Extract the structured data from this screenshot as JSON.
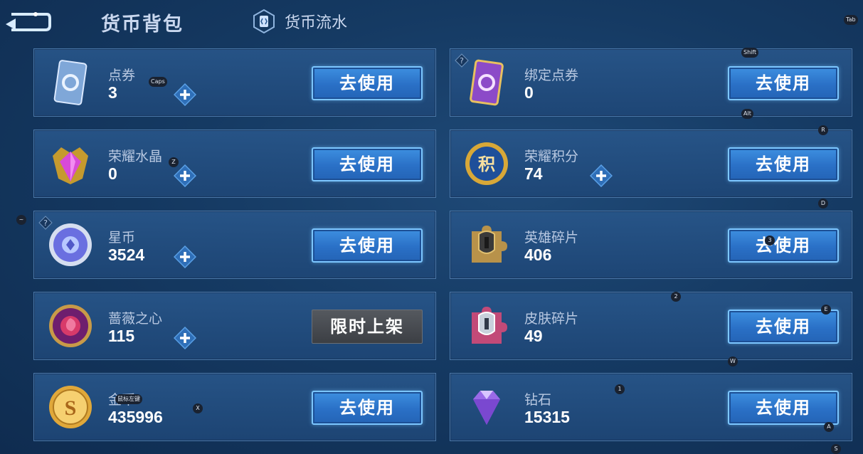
{
  "header": {
    "back_icon": "back-arrow-icon",
    "tab_backpack": "货币背包",
    "tab_flow": "货币流水",
    "flow_icon": "currency-flow-icon"
  },
  "use_label": "去使用",
  "left": [
    {
      "name": "点券",
      "amount": "3",
      "icon": "coupon-card-icon",
      "plus": true
    },
    {
      "name": "荣耀水晶",
      "amount": "0",
      "icon": "glory-crystal-icon",
      "plus": true
    },
    {
      "name": "星币",
      "amount": "3524",
      "icon": "star-coin-icon",
      "plus": true,
      "help": true
    },
    {
      "name": "蔷薇之心",
      "amount": "115",
      "icon": "rose-heart-icon",
      "plus": true,
      "button": "限时上架"
    },
    {
      "name": "金币",
      "amount": "435996",
      "icon": "gold-coin-icon",
      "plus": false
    }
  ],
  "right": [
    {
      "name": "绑定点券",
      "amount": "0",
      "icon": "bound-coupon-icon",
      "help": true
    },
    {
      "name": "荣耀积分",
      "amount": "74",
      "icon": "glory-points-icon",
      "plus": true
    },
    {
      "name": "英雄碎片",
      "amount": "406",
      "icon": "hero-fragment-icon"
    },
    {
      "name": "皮肤碎片",
      "amount": "49",
      "icon": "skin-fragment-icon"
    },
    {
      "name": "钻石",
      "amount": "15315",
      "icon": "diamond-icon"
    }
  ],
  "key_hints": {
    "tab": "Tab",
    "shift": "Shift",
    "caps": "Caps",
    "alt": "Alt",
    "r": "R",
    "z": "Z",
    "d": "D",
    "tilde": "~",
    "three": "3",
    "two": "2",
    "e": "E",
    "w": "W",
    "one": "1",
    "x": "X",
    "a": "A",
    "s": "S",
    "gold_overlay": "鼠标左键"
  },
  "colors": {
    "use_button": "#2a70c6",
    "limited_button": "#4a4e54",
    "panel": "#1f4a7a"
  }
}
